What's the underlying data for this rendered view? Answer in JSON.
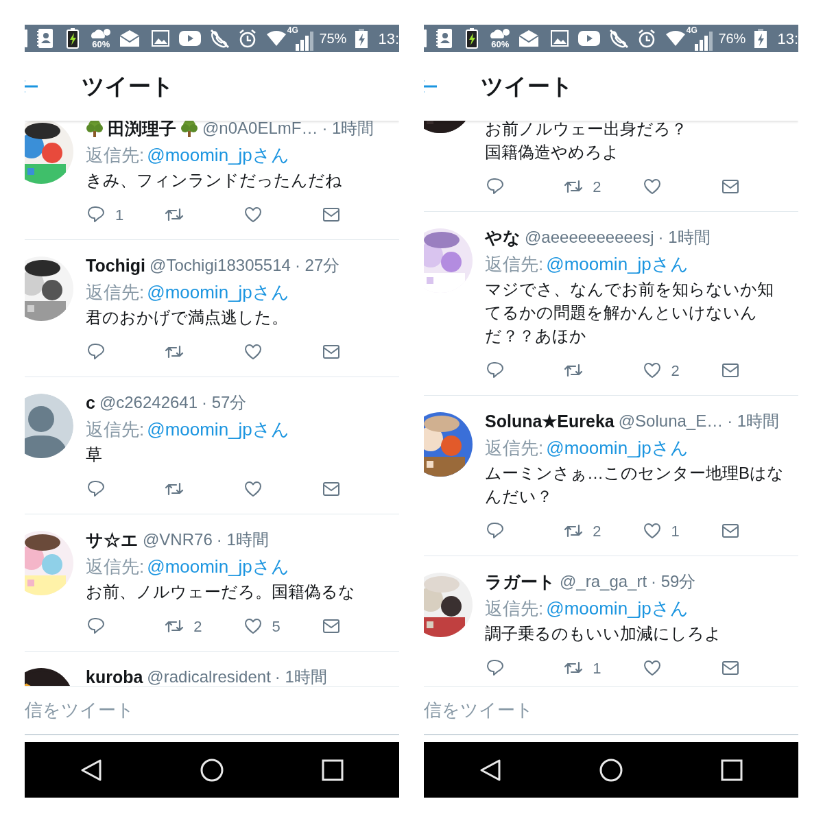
{
  "panels": [
    {
      "status_bar": {
        "weather": "60%",
        "network": "4G",
        "battery": "75%",
        "time": "13:"
      },
      "header": {
        "title": "ツイート"
      },
      "tweets": [
        {
          "avatar": {
            "kind": "picture"
          },
          "name": "田渕理子",
          "decorated": true,
          "handle": "@n0A0ELmF…",
          "time": "· 1時間",
          "reply_prefix": "返信先:",
          "reply_to": "@moomin_jpさん",
          "lines": [
            "きみ、フィンランドだったんだね"
          ],
          "replies": "1"
        },
        {
          "avatar": {
            "kind": "picture"
          },
          "name": "Tochigi",
          "decorated": false,
          "handle": "@Tochigi18305514",
          "time": "· 27分",
          "reply_prefix": "返信先:",
          "reply_to": "@moomin_jpさん",
          "lines": [
            "君のおかげで満点逃した。"
          ]
        },
        {
          "avatar": {
            "kind": "default"
          },
          "name": "c",
          "decorated": false,
          "handle": "@c26242641",
          "time": "· 57分",
          "reply_prefix": "返信先:",
          "reply_to": "@moomin_jpさん",
          "lines": [
            "草"
          ]
        },
        {
          "avatar": {
            "kind": "picture"
          },
          "name": "サ☆エ",
          "decorated": false,
          "handle": "@VNR76",
          "time": "· 1時間",
          "reply_prefix": "返信先:",
          "reply_to": "@moomin_jpさん",
          "lines": [
            "お前、ノルウェーだろ。国籍偽るな"
          ],
          "retweets": "2",
          "likes": "5"
        },
        {
          "avatar": {
            "kind": "picture"
          },
          "name": "kuroba",
          "decorated": false,
          "handle": "@radicalresident",
          "time": "· 1時間"
        }
      ],
      "reply_field": {
        "placeholder": "信をツイート"
      }
    },
    {
      "status_bar": {
        "weather": "60%",
        "network": "4G",
        "battery": "76%",
        "time": "13:"
      },
      "header": {
        "title": "ツイート"
      },
      "tweets": [
        {
          "avatar": {
            "kind": "picture"
          },
          "lines": [
            "お前ノルウェー出身だろ？",
            "国籍偽造やめろよ"
          ],
          "retweets": "2"
        },
        {
          "avatar": {
            "kind": "picture"
          },
          "name": "やな",
          "decorated": false,
          "handle": "@aeeeeeeeeeesj",
          "time": "· 1時間",
          "reply_prefix": "返信先:",
          "reply_to": "@moomin_jpさん",
          "lines": [
            "マジでさ、なんでお前を知らないか知",
            "てるかの問題を解かんといけないん",
            "だ？？あほか"
          ],
          "likes": "2"
        },
        {
          "avatar": {
            "kind": "picture"
          },
          "name": "Soluna★Eureka",
          "decorated": false,
          "handle": "@Soluna_E…",
          "time": "· 1時間",
          "reply_prefix": "返信先:",
          "reply_to": "@moomin_jpさん",
          "lines": [
            "ムーミンさぁ…このセンター地理Bはな",
            "んだい？"
          ],
          "retweets": "2",
          "likes": "1"
        },
        {
          "avatar": {
            "kind": "picture"
          },
          "name": "ラガート",
          "decorated": false,
          "handle": "@_ra_ga_rt",
          "time": "· 59分",
          "reply_prefix": "返信先:",
          "reply_to": "@moomin_jpさん",
          "lines": [
            "調子乗るのもいい加減にしろよ"
          ],
          "retweets": "1"
        }
      ],
      "reply_field": {
        "placeholder": "信をツイート"
      }
    }
  ]
}
